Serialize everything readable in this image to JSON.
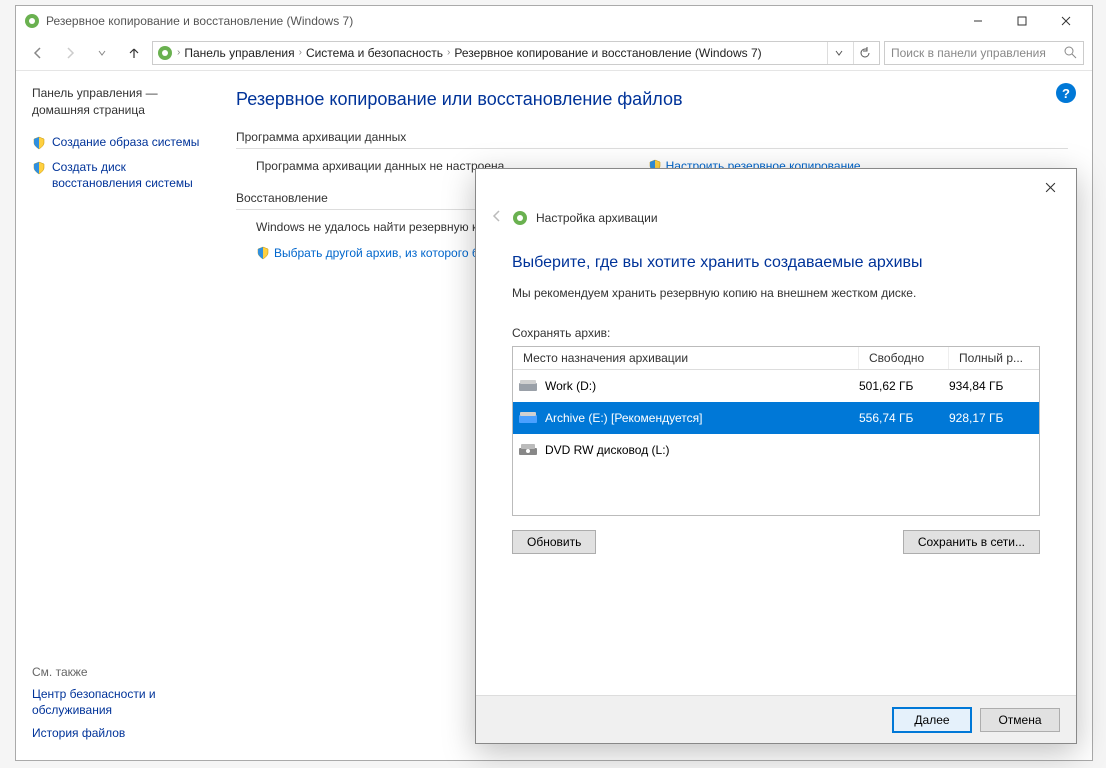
{
  "titlebar": {
    "title": "Резервное копирование и восстановление (Windows 7)"
  },
  "breadcrumb": {
    "items": [
      "Панель управления",
      "Система и безопасность",
      "Резервное копирование и восстановление (Windows 7)"
    ]
  },
  "search": {
    "placeholder": "Поиск в панели управления"
  },
  "sidebar": {
    "home": "Панель управления — домашняя страница",
    "links": [
      "Создание образа системы",
      "Создать диск восстановления системы"
    ],
    "see_also": "См. также",
    "bottom_links": [
      "Центр безопасности и обслуживания",
      "История файлов"
    ]
  },
  "main": {
    "heading": "Резервное копирование или восстановление файлов",
    "group1_title": "Программа архивации данных",
    "group1_text": "Программа архивации данных не настроена.",
    "group1_action": "Настроить резервное копирование",
    "group2_title": "Восстановление",
    "group2_text": "Windows не удалось найти резервную к",
    "group2_action": "Выбрать другой архив, из которого б"
  },
  "dialog": {
    "header": "Настройка архивации",
    "heading": "Выберите, где вы хотите хранить создаваемые архивы",
    "subtext": "Мы рекомендуем хранить резервную копию на внешнем жестком диске.",
    "save_label": "Сохранять архив:",
    "columns": [
      "Место назначения архивации",
      "Свободно",
      "Полный р..."
    ],
    "rows": [
      {
        "name": "Work (D:)",
        "free": "501,62 ГБ",
        "total": "934,84 ГБ",
        "type": "hdd",
        "selected": false
      },
      {
        "name": "Archive (E:) [Рекомендуется]",
        "free": "556,74 ГБ",
        "total": "928,17 ГБ",
        "type": "hdd",
        "selected": true
      },
      {
        "name": "DVD RW дисковод (L:)",
        "free": "",
        "total": "",
        "type": "dvd",
        "selected": false
      }
    ],
    "refresh": "Обновить",
    "save_network": "Сохранить в сети...",
    "next": "Далее",
    "cancel": "Отмена"
  }
}
